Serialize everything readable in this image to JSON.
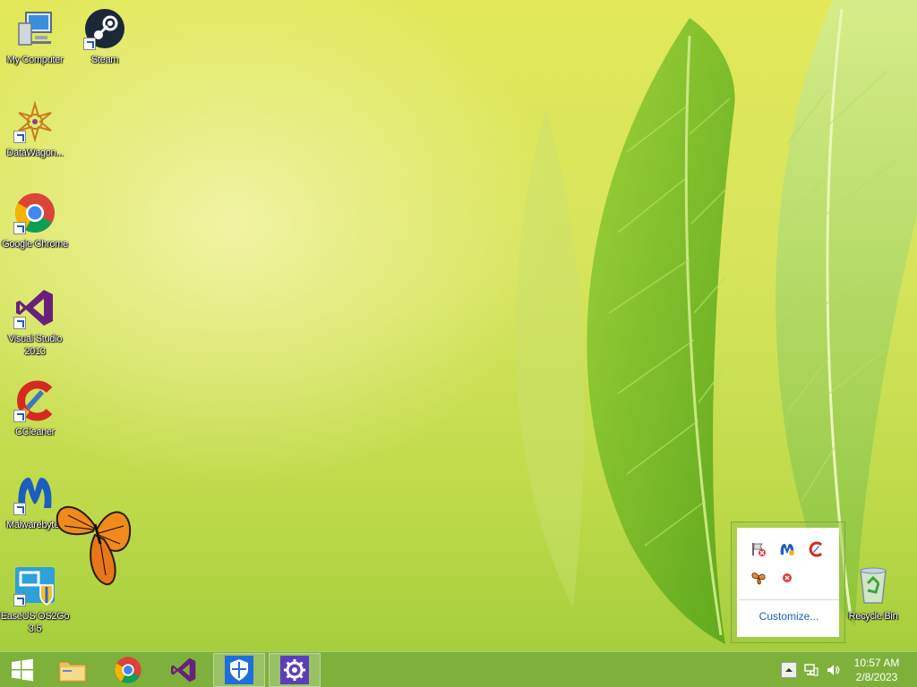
{
  "desktop": {
    "icons": [
      {
        "label": "My Computer",
        "icon": "computer-icon"
      },
      {
        "label": "Steam",
        "icon": "steam-icon"
      },
      {
        "label": "DataWagon...",
        "icon": "datawagon-icon"
      },
      {
        "label": "Google Chrome",
        "icon": "chrome-icon"
      },
      {
        "label": "Visual Studio 2013",
        "icon": "visual-studio-icon"
      },
      {
        "label": "CCleaner",
        "icon": "ccleaner-icon"
      },
      {
        "label": "Malwarebytes",
        "icon": "malwarebytes-icon"
      },
      {
        "label": "EaseUS OS2Go 3.5",
        "icon": "easeus-icon"
      },
      {
        "label": "Recycle Bin",
        "icon": "recycle-bin-icon"
      }
    ]
  },
  "tray_popup": {
    "icons": [
      "flag-icon",
      "malwarebytes-tray-icon",
      "ccleaner-tray-icon",
      "butterfly-tray-icon",
      "error-icon"
    ],
    "customize_label": "Customize..."
  },
  "taskbar": {
    "items": [
      "windows-start-icon",
      "file-explorer-icon",
      "chrome-icon",
      "visual-studio-icon",
      "shield-icon",
      "gear-icon"
    ],
    "clock": {
      "time": "10:57 AM",
      "date": "2/8/2023"
    }
  },
  "colors": {
    "taskbar": "#78aa3c",
    "link": "#1d5fb0"
  }
}
